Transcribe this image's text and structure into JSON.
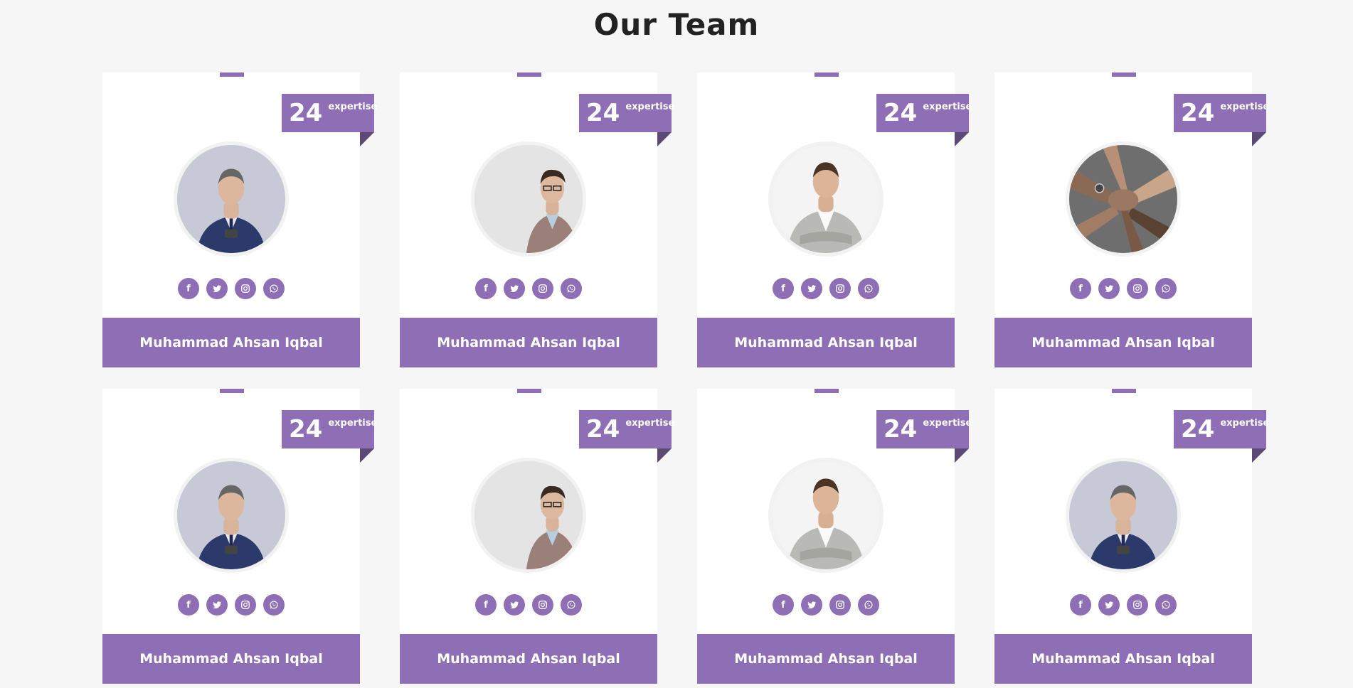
{
  "page": {
    "title": "Our Team"
  },
  "colors": {
    "accent": "#8e6fb5",
    "accent_dark": "#5b4a73",
    "background": "#f6f6f6",
    "card": "#ffffff"
  },
  "team": [
    {
      "name": "Muhammad Ahsan Iqbal",
      "expertise_number": "24",
      "expertise_label": "expertise",
      "photo": "man-navy-suit-phone"
    },
    {
      "name": "Muhammad Ahsan Iqbal",
      "expertise_number": "24",
      "expertise_label": "expertise",
      "photo": "man-tweed-jacket-glasses"
    },
    {
      "name": "Muhammad Ahsan Iqbal",
      "expertise_number": "24",
      "expertise_label": "expertise",
      "photo": "man-grey-blazer-arms-crossed"
    },
    {
      "name": "Muhammad Ahsan Iqbal",
      "expertise_number": "24",
      "expertise_label": "expertise",
      "photo": "team-hands-stacked"
    },
    {
      "name": "Muhammad Ahsan Iqbal",
      "expertise_number": "24",
      "expertise_label": "expertise",
      "photo": "man-navy-suit-phone"
    },
    {
      "name": "Muhammad Ahsan Iqbal",
      "expertise_number": "24",
      "expertise_label": "expertise",
      "photo": "man-tweed-jacket-glasses"
    },
    {
      "name": "Muhammad Ahsan Iqbal",
      "expertise_number": "24",
      "expertise_label": "expertise",
      "photo": "man-grey-blazer-arms-crossed"
    },
    {
      "name": "Muhammad Ahsan Iqbal",
      "expertise_number": "24",
      "expertise_label": "expertise",
      "photo": "man-navy-suit-phone"
    }
  ],
  "social_icons": [
    "facebook-icon",
    "twitter-icon",
    "instagram-icon",
    "whatsapp-icon"
  ]
}
